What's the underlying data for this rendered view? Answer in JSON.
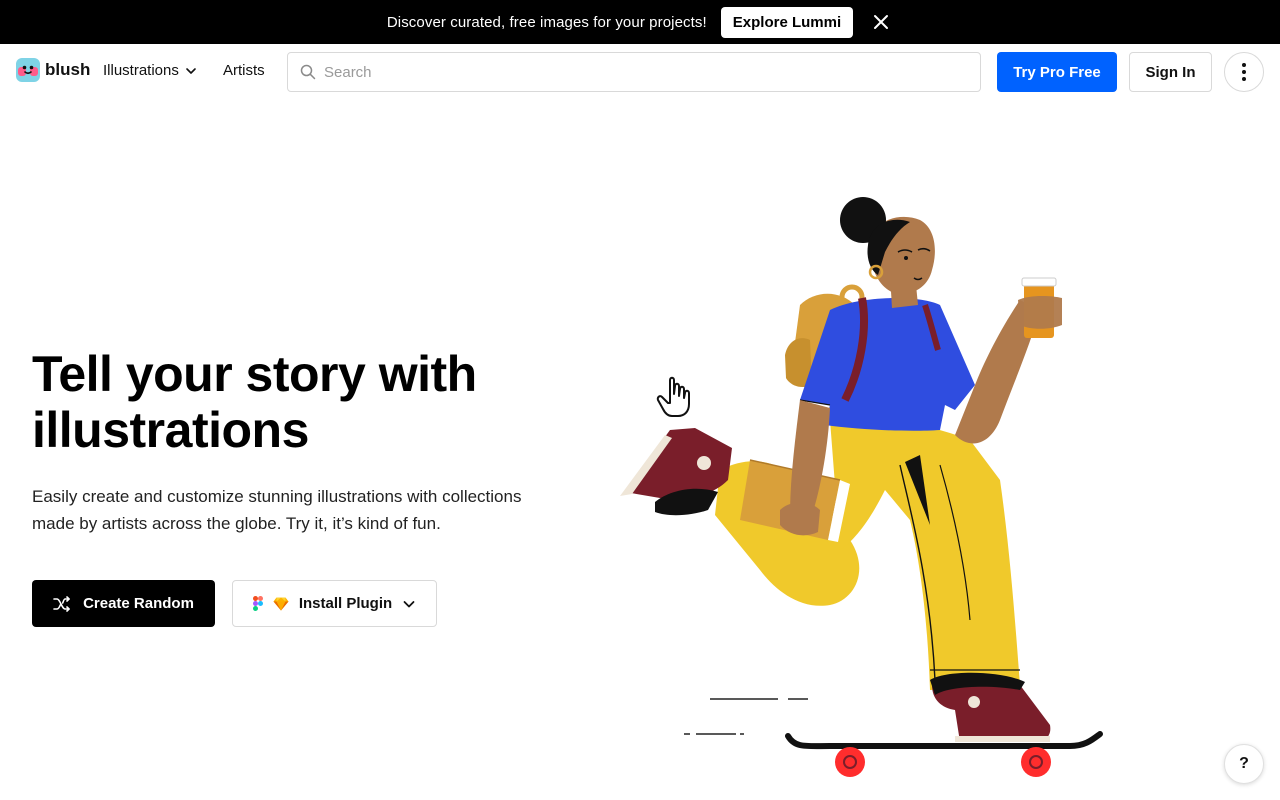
{
  "banner": {
    "text": "Discover curated, free images for your projects!",
    "cta_label": "Explore Lummi"
  },
  "nav": {
    "logo_text": "blush",
    "illustrations_label": "Illustrations",
    "artists_label": "Artists",
    "search_placeholder": "Search",
    "search_value": "",
    "try_pro_label": "Try Pro Free",
    "sign_in_label": "Sign In"
  },
  "hero": {
    "title": "Tell your story with illustrations",
    "subtitle": "Easily create and customize stunning illustrations with collections made by artists across the globe. Try it, it’s kind of fun.",
    "create_random_label": "Create Random",
    "install_plugin_label": "Install Plugin"
  },
  "help_label": "?",
  "colors": {
    "primary": "#0062ff",
    "banner_bg": "#000000",
    "shirt": "#2f4de0",
    "pants": "#f0c92b",
    "skin": "#b07a4c",
    "shoe": "#7a1e2a",
    "wheel": "#ff2d2d"
  },
  "icons": [
    "close-icon",
    "chevron-down-icon",
    "search-icon",
    "more-vertical-icon",
    "shuffle-icon",
    "figma-icon",
    "sketch-icon",
    "pointer-hand-icon"
  ]
}
